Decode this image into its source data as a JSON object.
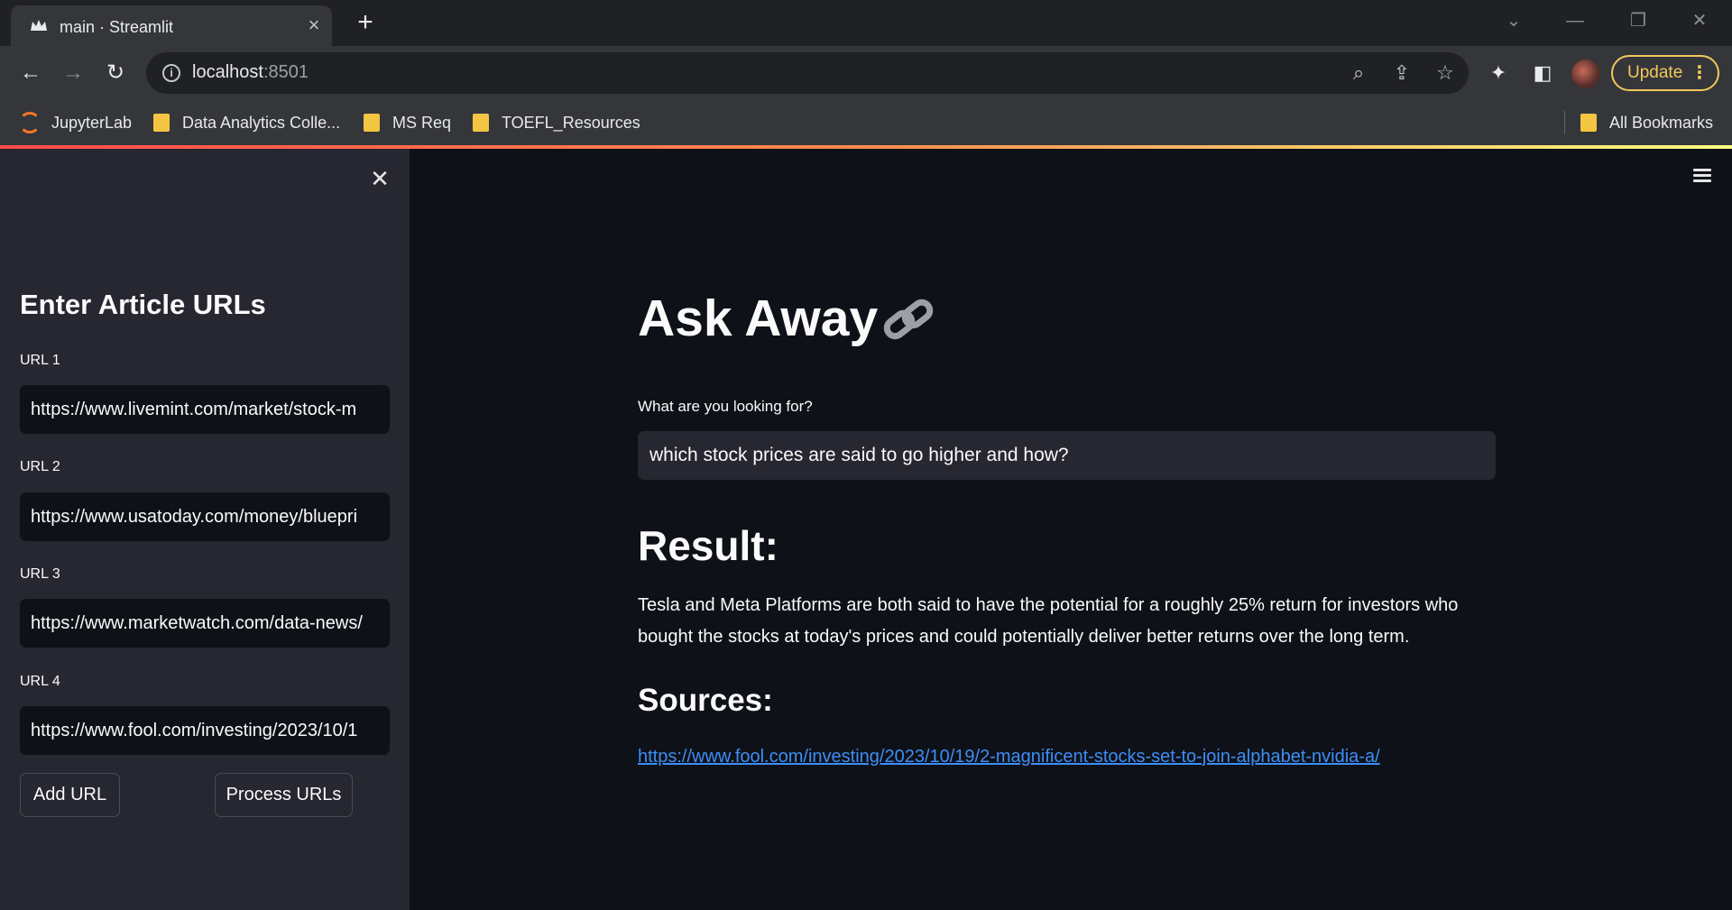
{
  "browser": {
    "tab_title": "main · Streamlit",
    "url_host": "localhost",
    "url_port": ":8501",
    "update_label": "Update",
    "bookmarks": [
      "JupyterLab",
      "Data Analytics Colle...",
      "MS Req",
      "TOEFL_Resources"
    ],
    "all_bookmarks_label": "All Bookmarks"
  },
  "sidebar": {
    "heading": "Enter Article URLs",
    "fields": [
      {
        "label": "URL 1",
        "value": "https://www.livemint.com/market/stock-m"
      },
      {
        "label": "URL 2",
        "value": "https://www.usatoday.com/money/bluepri"
      },
      {
        "label": "URL 3",
        "value": "https://www.marketwatch.com/data-news/"
      },
      {
        "label": "URL 4",
        "value": "https://www.fool.com/investing/2023/10/1"
      }
    ],
    "add_button": "Add URL",
    "process_button": "Process URLs"
  },
  "main": {
    "title": "Ask Away",
    "title_icon": "link-icon",
    "query_label": "What are you looking for?",
    "query_value": "which stock prices are said to go higher and how?",
    "result_heading": "Result:",
    "answer": "Tesla and Meta Platforms are both said to have the potential for a roughly 25% return for investors who bought the stocks at today's prices and could potentially deliver better returns over the long term.",
    "sources_heading": "Sources:",
    "source_link": "https://www.fool.com/investing/2023/10/19/2-magnificent-stocks-set-to-join-alphabet-nvidia-a/"
  },
  "colors": {
    "app_background": "#0e1117",
    "sidebar_background": "#262730",
    "link": "#3d8ef8",
    "update_accent": "#f2c85b"
  }
}
